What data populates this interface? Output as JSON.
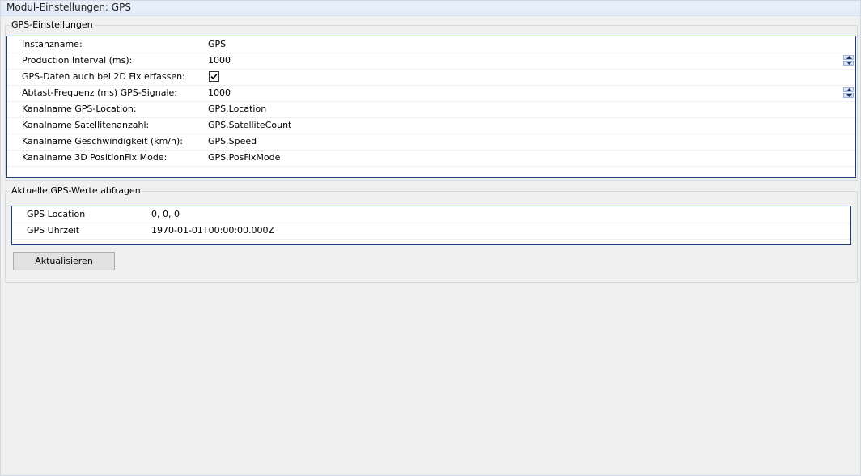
{
  "module": {
    "title": "Modul-Einstellungen: GPS"
  },
  "settings": {
    "group_title": "GPS-Einstellungen",
    "rows": [
      {
        "label": "Instanzname:",
        "value": "GPS"
      },
      {
        "label": "Production Interval (ms):",
        "value": "1000"
      },
      {
        "label": "GPS-Daten auch bei 2D Fix erfassen:",
        "value": ""
      },
      {
        "label": "Abtast-Frequenz (ms) GPS-Signale:",
        "value": "1000"
      },
      {
        "label": "Kanalname GPS-Location:",
        "value": "GPS.Location"
      },
      {
        "label": "Kanalname Satellitenanzahl:",
        "value": "GPS.SatelliteCount"
      },
      {
        "label": "Kanalname Geschwindigkeit (km/h):",
        "value": "GPS.Speed"
      },
      {
        "label": "Kanalname 3D PositionFix Mode:",
        "value": "GPS.PosFixMode"
      }
    ],
    "fix_2d_checked": true
  },
  "current_values": {
    "group_title": "Aktuelle GPS-Werte abfragen",
    "rows": [
      {
        "label": "GPS Location",
        "value": "0, 0, 0"
      },
      {
        "label": "GPS Uhrzeit",
        "value": "1970-01-01T00:00:00.000Z"
      }
    ],
    "refresh_button": "Aktualisieren"
  },
  "icons": {
    "checkmark": "checkmark-icon",
    "spin_up": "spin-up-icon",
    "spin_down": "spin-down-icon"
  },
  "colors": {
    "grid_border": "#1d3f7c",
    "header_bg": "#e1ebf8"
  }
}
